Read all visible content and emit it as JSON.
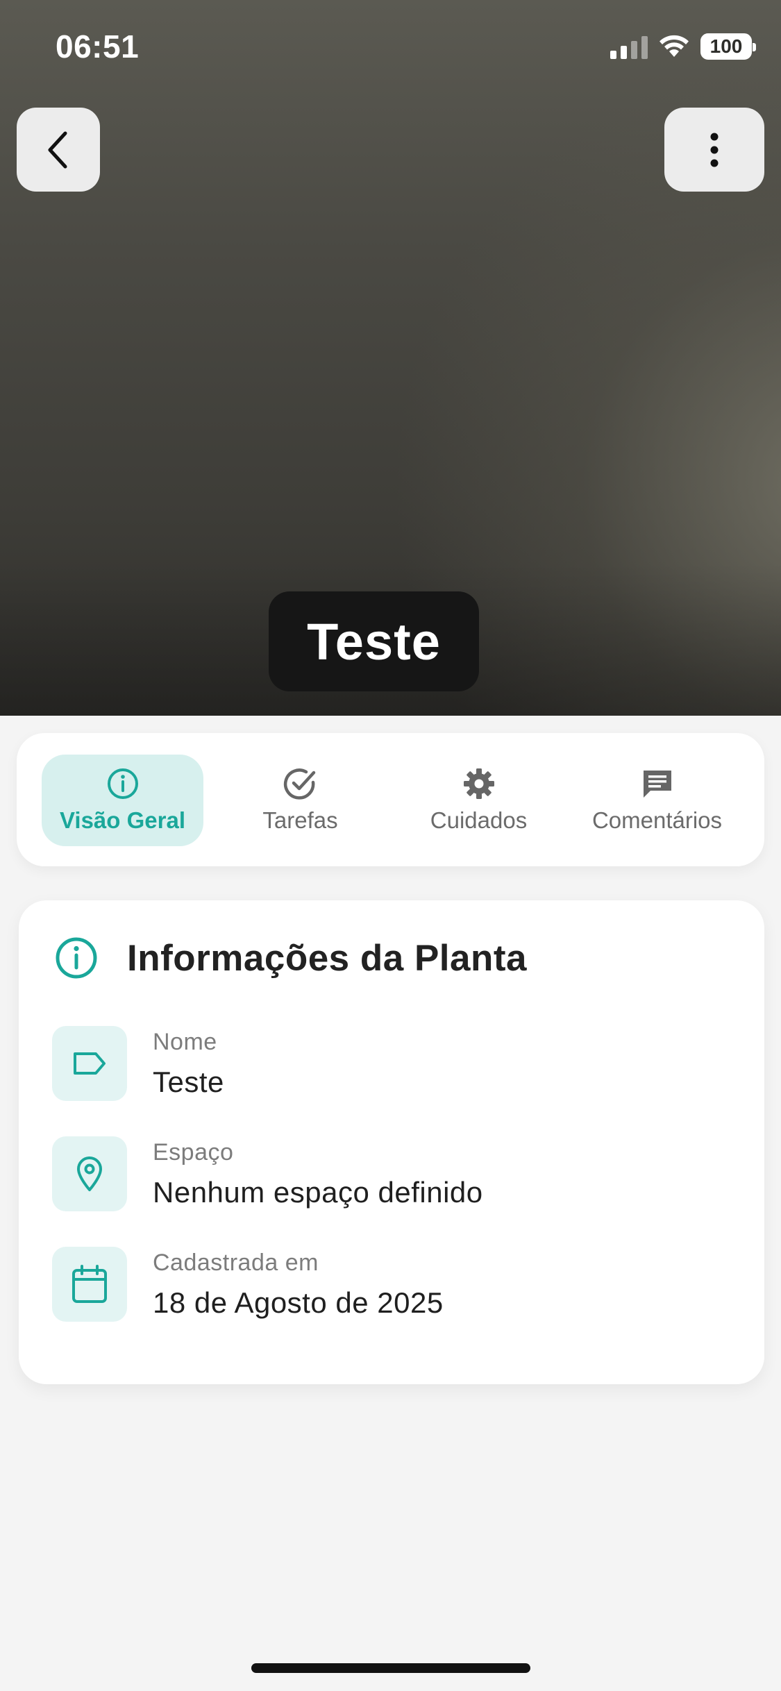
{
  "status_bar": {
    "time": "06:51",
    "battery": "100"
  },
  "header": {
    "plant_name": "Teste"
  },
  "tabs": [
    {
      "label": "Visão Geral",
      "icon": "info-icon",
      "active": true
    },
    {
      "label": "Tarefas",
      "icon": "check-circle-icon",
      "active": false
    },
    {
      "label": "Cuidados",
      "icon": "gear-icon",
      "active": false
    },
    {
      "label": "Comentários",
      "icon": "comment-icon",
      "active": false
    }
  ],
  "info_card": {
    "title": "Informações da Planta",
    "rows": [
      {
        "label": "Nome",
        "value": "Teste",
        "icon": "tag-icon"
      },
      {
        "label": "Espaço",
        "value": "Nenhum espaço definido",
        "icon": "location-pin-icon"
      },
      {
        "label": "Cadastrada em",
        "value": "18 de Agosto de 2025",
        "icon": "calendar-icon"
      }
    ]
  },
  "colors": {
    "accent": "#1aa79a",
    "accent_bg": "#d7f0ee",
    "background": "#f4f4f4"
  }
}
